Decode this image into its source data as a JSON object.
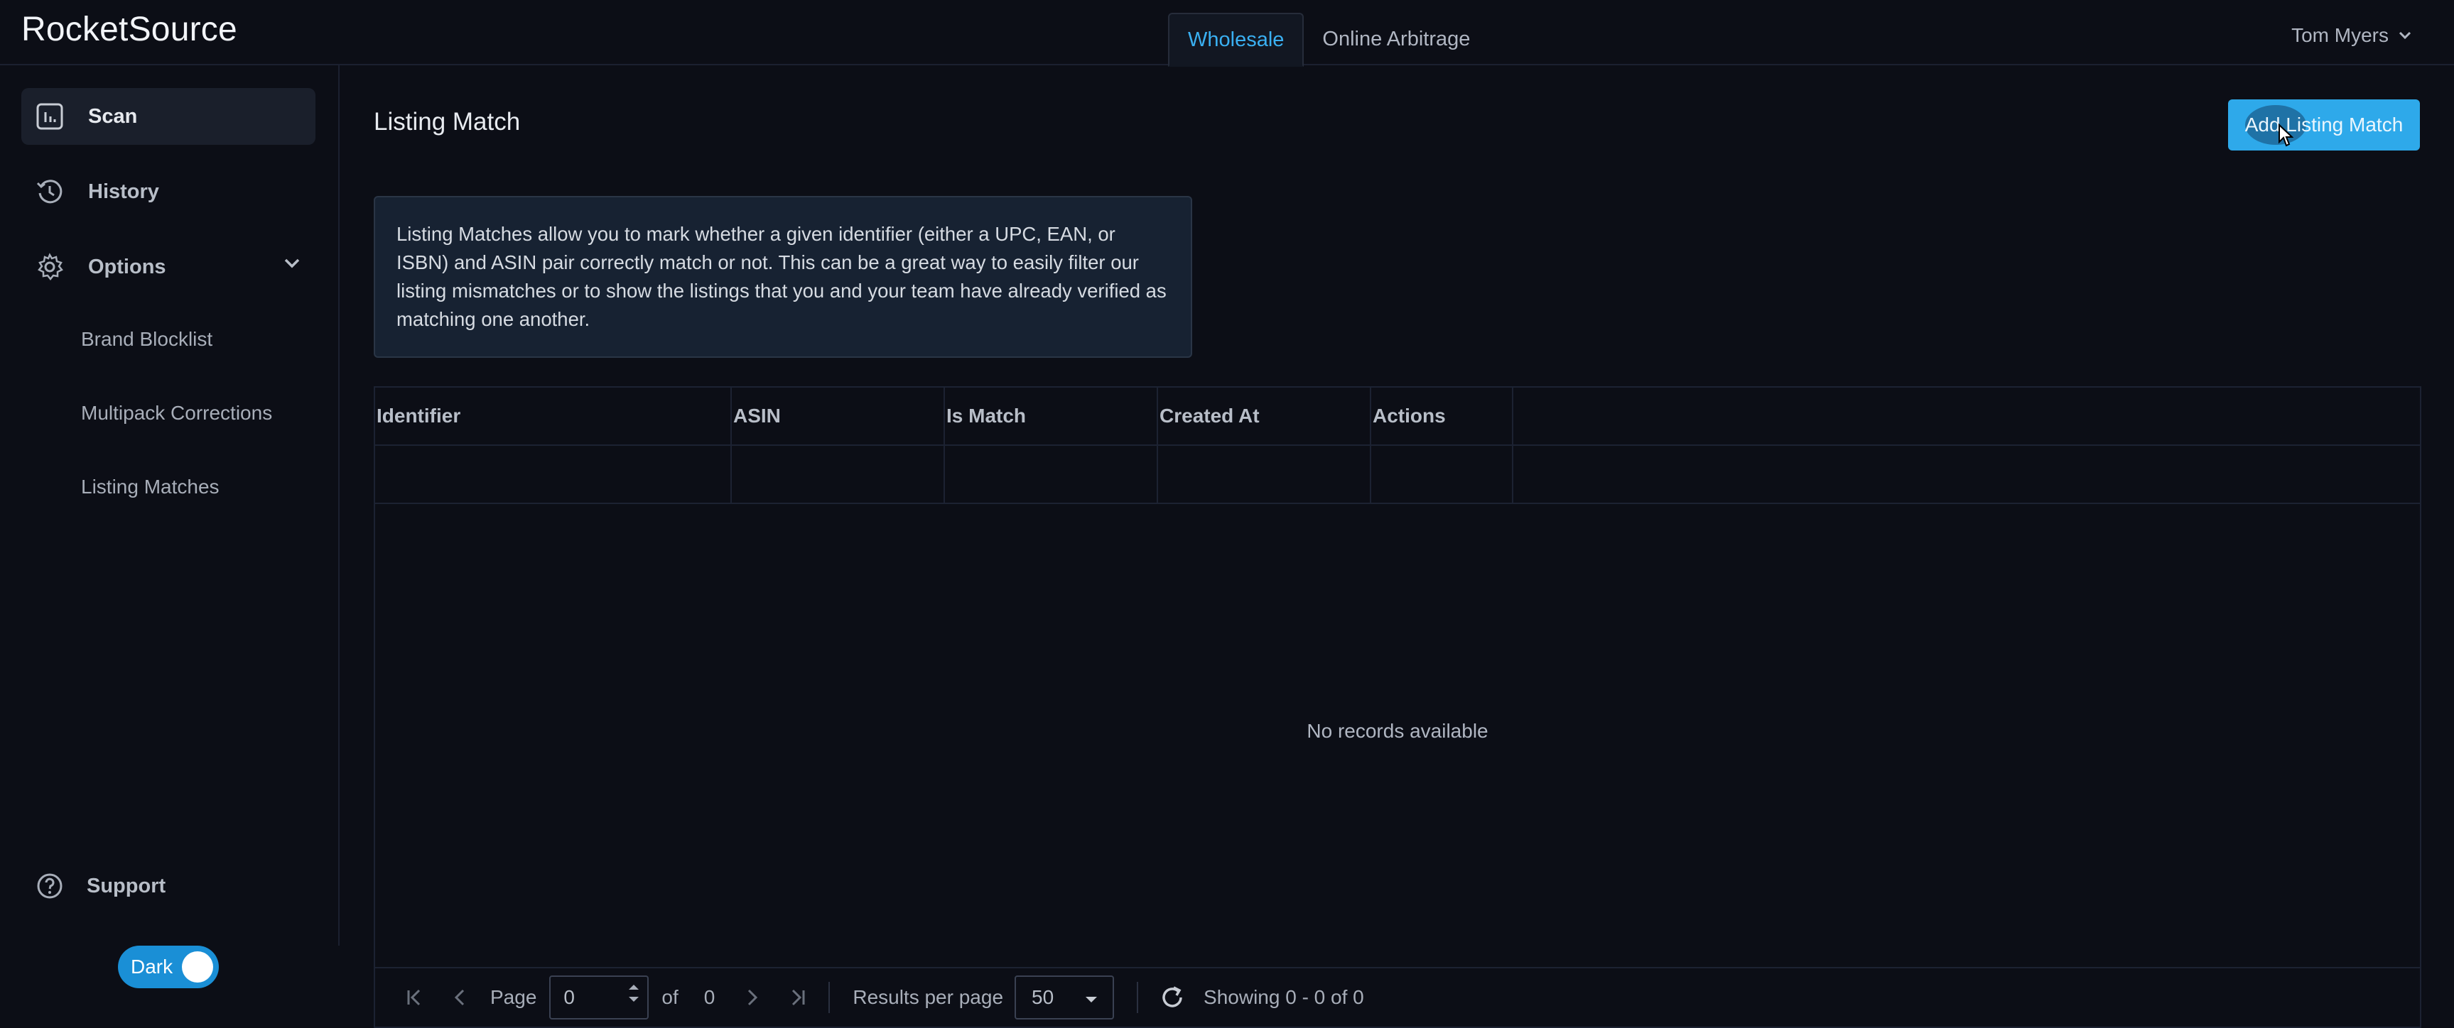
{
  "app": {
    "title": "RocketSource"
  },
  "header": {
    "tabs": [
      {
        "label": "Wholesale",
        "active": true
      },
      {
        "label": "Online Arbitrage",
        "active": false
      }
    ],
    "user_name": "Tom Myers"
  },
  "sidebar": {
    "items": [
      {
        "label": "Scan",
        "icon": "chart-icon",
        "active": true
      },
      {
        "label": "History",
        "icon": "history-icon"
      },
      {
        "label": "Options",
        "icon": "gear-icon",
        "expanded": true
      }
    ],
    "options_subitems": [
      "Brand Blocklist",
      "Multipack Corrections",
      "Listing Matches"
    ],
    "support_label": "Support",
    "theme_toggle_label": "Dark"
  },
  "main": {
    "title": "Listing Match",
    "add_button_label": "Add Listing Match",
    "info_text": "Listing Matches allow you to mark whether a given identifier (either a UPC, EAN, or ISBN) and ASIN pair correctly match or not. This can be a great way to easily filter our listing mismatches or to show the listings that you and your team have already verified as matching one another."
  },
  "grid": {
    "columns": [
      "Identifier",
      "ASIN",
      "Is Match",
      "Created At",
      "Actions"
    ],
    "empty_message": "No records available",
    "pager": {
      "page_label": "Page",
      "page_value": "0",
      "of_label": "of",
      "total_pages": "0",
      "results_per_page_label": "Results per page",
      "results_per_page_value": "50",
      "showing_text": "Showing 0 - 0 of 0"
    }
  },
  "colors": {
    "accent": "#2ea9ea",
    "background": "#0c0e16",
    "info_background": "#172232"
  }
}
